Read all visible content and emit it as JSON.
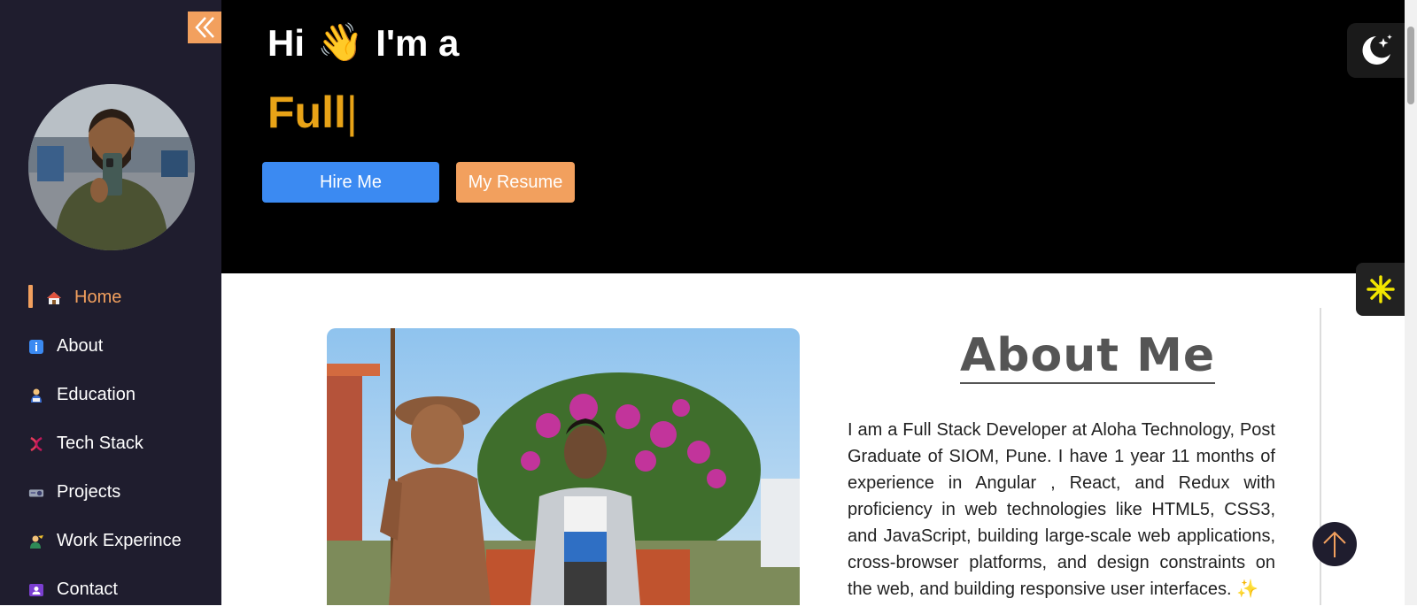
{
  "sidebar": {
    "collapse_icon": "double-chevron-left-icon",
    "avatar_alt": "profile-photo",
    "items": [
      {
        "label": "Home",
        "icon": "home-icon",
        "active": true
      },
      {
        "label": "About",
        "icon": "info-icon",
        "active": false
      },
      {
        "label": "Education",
        "icon": "student-icon",
        "active": false
      },
      {
        "label": "Tech Stack",
        "icon": "dna-icon",
        "active": false
      },
      {
        "label": "Projects",
        "icon": "projector-icon",
        "active": false
      },
      {
        "label": "Work Experince",
        "icon": "worker-icon",
        "active": false
      },
      {
        "label": "Contact",
        "icon": "contact-icon",
        "active": false
      }
    ]
  },
  "hero": {
    "greeting_hi": "Hi",
    "greeting_wave": "👋",
    "greeting_rest": "I'm a",
    "typed_text": "Full",
    "caret": "|",
    "hire_button": "Hire Me",
    "resume_button": "My Resume"
  },
  "about": {
    "title": "About Me",
    "paragraph": "I am a Full Stack Developer at Aloha Technology, Post Graduate of SIOM, Pune. I have 1 year 11 months of experience in Angular , React, and Redux with proficiency in web technologies like HTML5, CSS3, and JavaScript, building large-scale web applications, cross-browser platforms, and design constraints on the web, and building responsive user interfaces. ✨"
  },
  "colors": {
    "sidebar_bg": "#1f1d2e",
    "accent_orange": "#f2a05e",
    "accent_blue": "#3b8af2",
    "typed_yellow": "#e8a317",
    "hero_bg": "#000000"
  }
}
